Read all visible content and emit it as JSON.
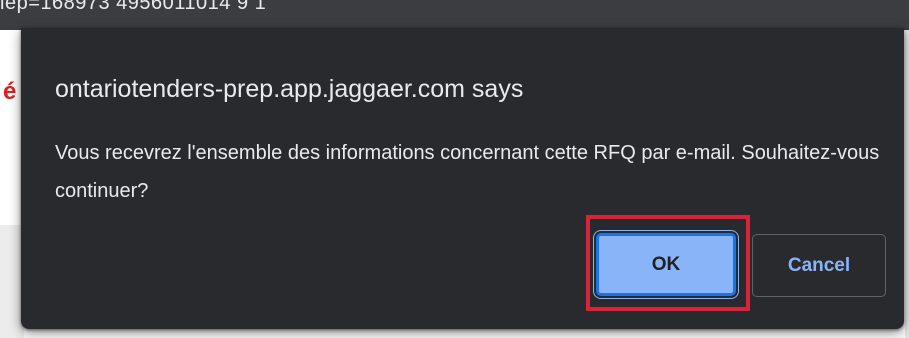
{
  "background": {
    "topbar_text": "iep=168973 4956011014 9 1",
    "red_fragment": "é"
  },
  "dialog": {
    "title": "ontariotenders-prep.app.jaggaer.com says",
    "message": "Vous recevrez l'ensemble des informations concernant cette RFQ par e-mail. Souhaitez-vous continuer?",
    "ok_label": "OK",
    "cancel_label": "Cancel"
  },
  "colors": {
    "dialog_background": "#292a2d",
    "text": "#e8eaed",
    "ok_button": "#8ab4f8",
    "cancel_text": "#8ab4f8",
    "highlight": "#d8233a"
  }
}
